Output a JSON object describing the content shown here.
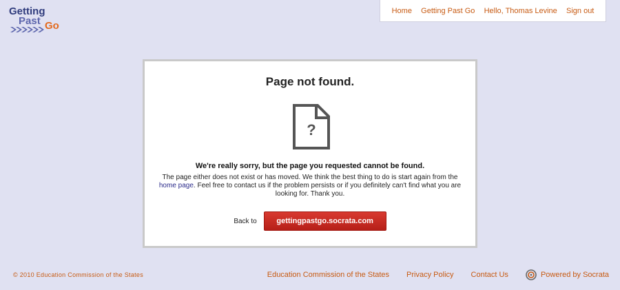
{
  "logo": {
    "line1": "Getting",
    "line2": "Past",
    "line2_accent": "Go",
    "colors": {
      "navy": "#2e3a7c",
      "accent": "#e36a1e",
      "arrows": "#5d66ad"
    }
  },
  "nav": {
    "items": [
      {
        "label": "Home"
      },
      {
        "label": "Getting Past Go"
      },
      {
        "label": "Hello, Thomas Levine"
      },
      {
        "label": "Sign out"
      }
    ]
  },
  "error": {
    "title": "Page not found.",
    "icon": "document-question-icon",
    "sorry": "We're really sorry, but the page you requested cannot be found.",
    "explain_before": "The page either does not exist or has moved. We think the best thing to do is start again from the",
    "home_link": "home page",
    "explain_after": ". Feel free to contact us if the problem persists or if you definitely can't find what you are looking for. Thank you.",
    "back_label": "Back to",
    "back_button": "gettingpastgo.socrata.com"
  },
  "footer": {
    "copyright": "© 2010 Education Commission of the States",
    "links": [
      {
        "label": "Education Commission of the States"
      },
      {
        "label": "Privacy Policy"
      },
      {
        "label": "Contact Us"
      }
    ],
    "powered": "Powered by Socrata",
    "powered_icon": "socrata-logo-icon"
  },
  "colors": {
    "page_bg": "#e0e1f2",
    "link": "#c75a12",
    "button": "#c62a22"
  }
}
